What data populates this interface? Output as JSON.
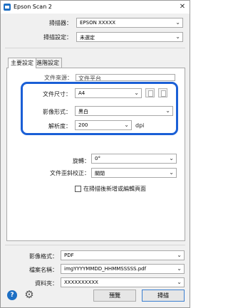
{
  "window": {
    "title": "Epson Scan 2",
    "close_glyph": "✕"
  },
  "header": {
    "scanner_label": "掃描器：",
    "scanner_value": "EPSON XXXXX",
    "settings_label": "掃描設定：",
    "settings_value": "未選定"
  },
  "tabs": [
    {
      "label": "主要設定"
    },
    {
      "label": "進階設定"
    }
  ],
  "main": {
    "doc_source_partial": "文件來源：",
    "doc_source_value_partial": "文件平台",
    "doc_size_label": "文件尺寸：",
    "doc_size_value": "A4",
    "image_type_label": "影像形式：",
    "image_type_value": "黑白",
    "resolution_label": "解析度：",
    "resolution_value": "200",
    "resolution_unit": "dpi",
    "rotate_label": "旋轉：",
    "rotate_value": "0°",
    "skew_label": "文件歪斜校正：",
    "skew_value": "關閉",
    "checkbox_label": "在掃描後新增或編輯頁面"
  },
  "output": {
    "format_label": "影像格式：",
    "format_value": "PDF",
    "filename_label": "檔案名稱：",
    "filename_value": "imgYYYYMMDD_HHMMSSSSS.pdf",
    "folder_label": "資料夾：",
    "folder_value": "XXXXXXXXXX"
  },
  "footer": {
    "preview_button": "預覽",
    "scan_button": "掃描",
    "help_glyph": "?",
    "settings_glyph": "⚙"
  },
  "colors": {
    "callout_border": "#1a5fd6",
    "accent": "#1d6fc4"
  }
}
